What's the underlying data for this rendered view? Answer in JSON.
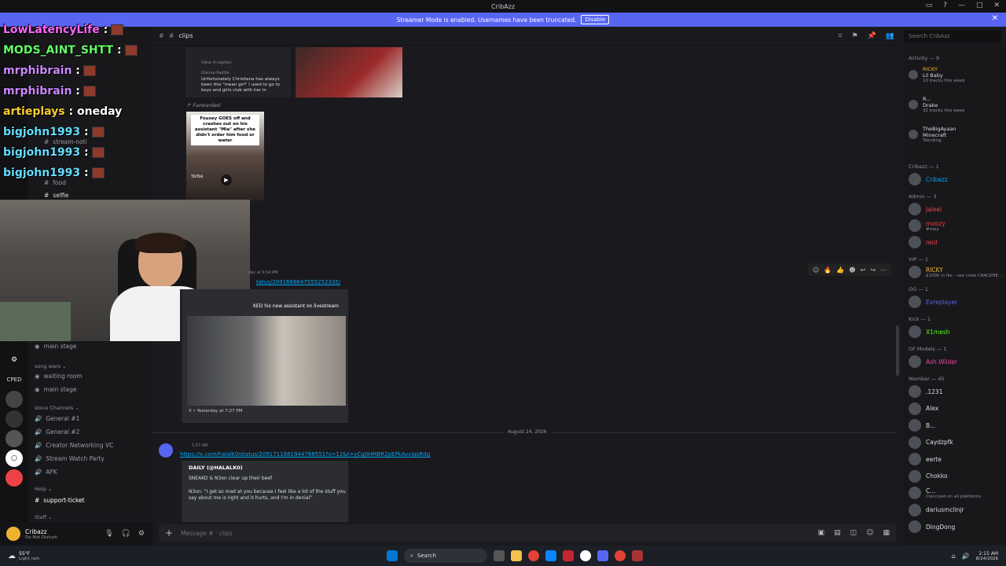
{
  "window": {
    "title": "CribAzz"
  },
  "banner": {
    "text": "Streamer Mode is enabled. Usernames have been truncated.",
    "button": "Disable"
  },
  "channel": {
    "name": "clips",
    "search_placeholder": "Search CribAzz",
    "input_placeholder": "Message # · clips"
  },
  "overlay_chat": [
    {
      "user": "LowLatencyLife",
      "color": "#ff66ff",
      "suffix": " :"
    },
    {
      "user": "MODS_AINT_SHTT",
      "color": "#66ff66",
      "suffix": " :"
    },
    {
      "user": "mrphibrain",
      "color": "#cc88ff",
      "suffix": " :"
    },
    {
      "user": "mrphibrain",
      "color": "#cc88ff",
      "suffix": " :"
    },
    {
      "user": "artieplays",
      "color": "#ffcc33",
      "suffix": " : oneday"
    },
    {
      "user": "bigjohn1993",
      "color": "#66ddff",
      "suffix": " :"
    },
    {
      "user": "bigjohn1993",
      "color": "#66ddff",
      "suffix": " :"
    },
    {
      "user": "bigjohn1993",
      "color": "#66ddff",
      "suffix": " :"
    }
  ],
  "sidebar": {
    "stage_label": "main stage",
    "category_songwars": "song wars",
    "waiting_room": "waiting room",
    "main_stage_2": "main stage",
    "category_voice": "Voice Channels",
    "voice": [
      "General #1",
      "General #2",
      "Creator Networking VC",
      "Stream Watch Party",
      "AFK"
    ],
    "category_help": "Help",
    "support": "support-ticket",
    "category_staff": "Staff",
    "upper_channels": [
      "stream-noti",
      "food",
      "selfie"
    ],
    "server_label": "CPED"
  },
  "user": {
    "name": "Cribazz",
    "status": "Do Not Disturb"
  },
  "messages": {
    "snippet_reply": "View 4 replies",
    "snippet_author": "Gianna Padilla",
    "snippet_text": "Unfortunately Christiana has always been this \"mean girl\" I used to go to boys and girls club with her in",
    "forwarded": "Forwarded",
    "tiktok_caption": "Fousey GOES off and crashes out on his assistant \"Mia\" after she didn't order him food or water",
    "tiktok_label": "TikTok",
    "link1": "tatus/2091668647555252335/",
    "time1": "day at 9:54 PM",
    "embed1_title": "KED his new assistant on livestream",
    "embed1_footer": "X • Yesterday at 7:27 PM",
    "date_divider": "August 24, 2026",
    "time2": "1:57 AM",
    "link2": "https://x.com/halalk0/status/2091711681944768551?s=12&t=yCg0HMBR2pEPkAvviqsRdg",
    "embed2_title": "DAILY (@HALALK0)",
    "embed2_line1": "SNEAKO & N3on clear up their beef",
    "embed2_line2": "N3on: \"I get so mad at you because I feel like a lot of the stuff you say about me is right and it hurts, and I'm in denial\""
  },
  "members": {
    "activity_header": "Activity — 9",
    "activity": [
      {
        "name": "RICKY",
        "sub": "Lil Baby",
        "detail": "10 tracks this week",
        "color": "#f0b232"
      },
      {
        "name": "R...",
        "sub": "Drake",
        "detail": "32 tracks this week",
        "color": "#dbdee1"
      },
      {
        "name": "TheBigAyaan",
        "sub": "Minecraft",
        "detail": "Trending",
        "color": "#dbdee1"
      }
    ],
    "groups": [
      {
        "header": "Cribazz — 1",
        "items": [
          {
            "name": "Cribazz",
            "color": "#00a8fc",
            "sub": ""
          }
        ]
      },
      {
        "header": "Admin — 3",
        "items": [
          {
            "name": "Jaleel",
            "color": "#ed4245",
            "sub": ""
          },
          {
            "name": "moozy",
            "color": "#ed4245",
            "sub": "#moy"
          },
          {
            "name": "reid",
            "color": "#ed4245",
            "sub": ""
          }
        ]
      },
      {
        "header": "VIP — 1",
        "items": [
          {
            "name": "RICKY",
            "color": "#f0b232",
            "sub": "$1000 in lbs - use code CRACKHE..."
          }
        ]
      },
      {
        "header": "OG — 1",
        "items": [
          {
            "name": "Evreplayer",
            "color": "#5865f2",
            "sub": ""
          }
        ]
      },
      {
        "header": "Kick — 1",
        "items": [
          {
            "name": "X1mesh",
            "color": "#53fc18",
            "sub": ""
          }
        ]
      },
      {
        "header": "OF Models — 1",
        "items": [
          {
            "name": "Ash Wilder",
            "color": "#eb459e",
            "sub": ""
          }
        ]
      },
      {
        "header": "Member — 45",
        "items": [
          {
            "name": ".1231",
            "color": "#dbdee1",
            "sub": ""
          },
          {
            "name": "Alex",
            "color": "#dbdee1",
            "sub": ""
          },
          {
            "name": "B...",
            "color": "#dbdee1",
            "sub": ""
          },
          {
            "name": "Caydzpfk",
            "color": "#dbdee1",
            "sub": ""
          },
          {
            "name": "eerte",
            "color": "#dbdee1",
            "sub": ""
          },
          {
            "name": "Chokko",
            "color": "#dbdee1",
            "sub": ""
          },
          {
            "name": "C...",
            "color": "#dbdee1",
            "sub": "Clancyed on all platforms"
          },
          {
            "name": "dariusmclinjr",
            "color": "#dbdee1",
            "sub": ""
          },
          {
            "name": "DingDong",
            "color": "#dbdee1",
            "sub": ""
          }
        ]
      }
    ]
  },
  "taskbar": {
    "weather_temp": "55°F",
    "weather_text": "Light rain",
    "search": "Search",
    "time": "2:15 AM",
    "date": "8/24/2026"
  }
}
